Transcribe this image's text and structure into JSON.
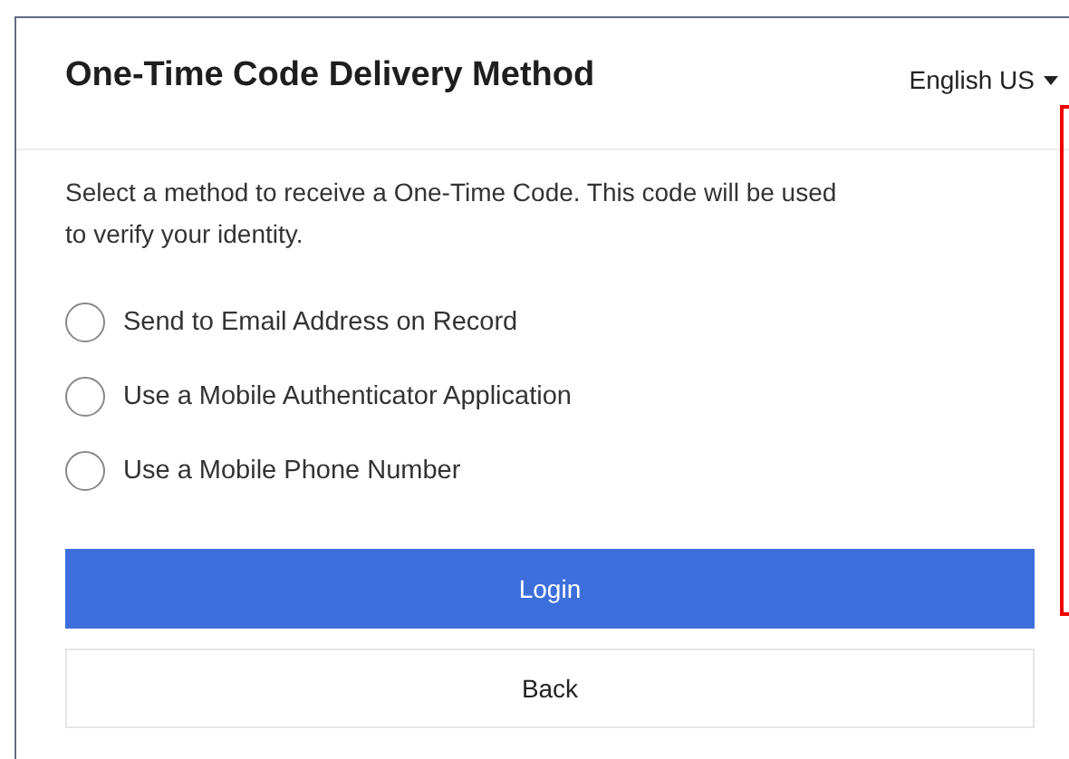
{
  "header": {
    "title": "One-Time Code Delivery Method",
    "language": "English US"
  },
  "description": "Select a method to receive a One-Time Code. This code will be used to verify your identity.",
  "options": [
    {
      "label": "Send to Email Address on Record",
      "selected": false
    },
    {
      "label": "Use a Mobile Authenticator Application",
      "selected": false
    },
    {
      "label": "Use a Mobile Phone Number",
      "selected": false
    }
  ],
  "buttons": [
    {
      "label": "Login",
      "kind": "primary"
    },
    {
      "label": "Back",
      "kind": "secondary"
    }
  ]
}
